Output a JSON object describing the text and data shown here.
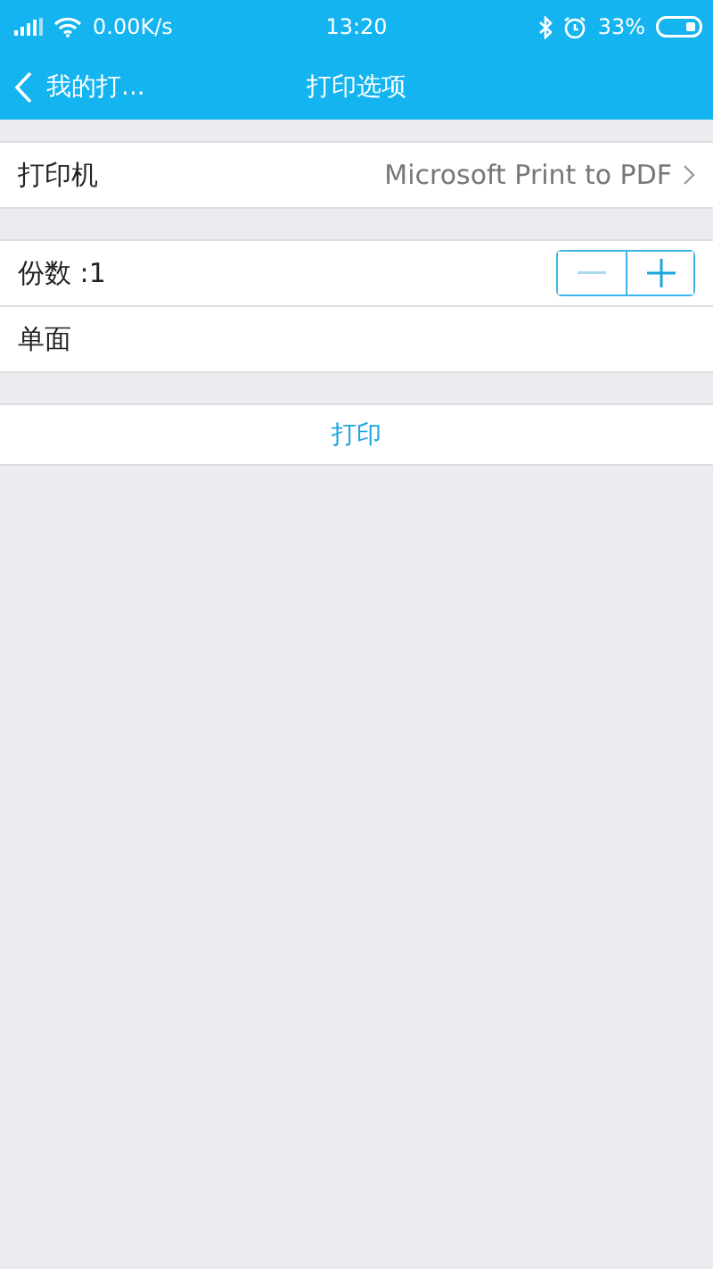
{
  "status_bar": {
    "speed": "0.00K/s",
    "time": "13:20",
    "battery": "33%"
  },
  "nav": {
    "back_label": "我的打...",
    "title": "打印选项"
  },
  "printer": {
    "label": "打印机",
    "value": "Microsoft Print to PDF"
  },
  "copies": {
    "label": "份数 :1",
    "decrement_disabled": true,
    "increment_disabled": false
  },
  "duplex": {
    "label": "单面"
  },
  "print_button": "打印"
}
